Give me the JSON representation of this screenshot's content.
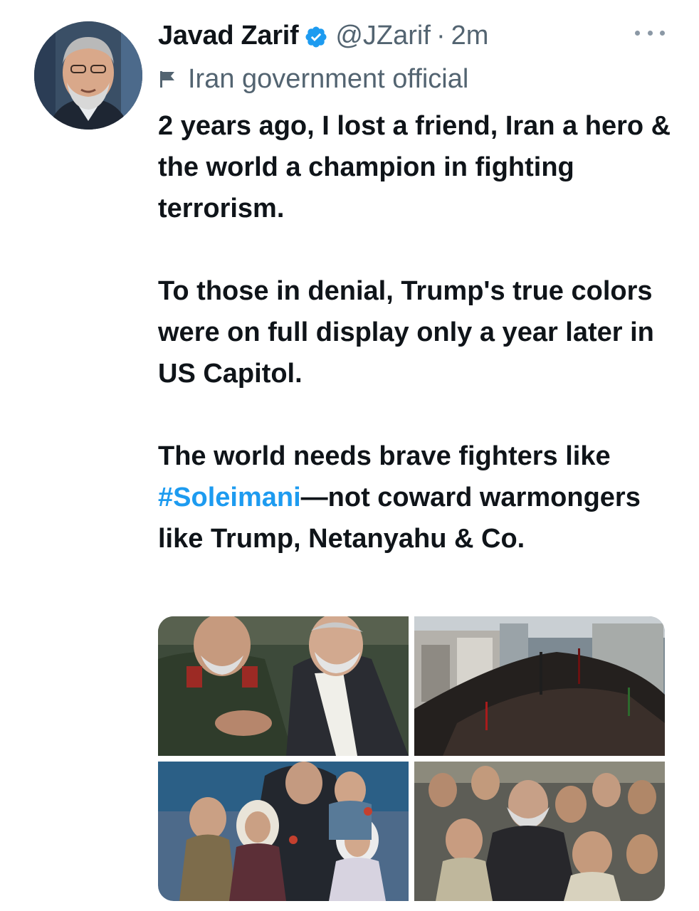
{
  "tweet": {
    "author": {
      "display_name": "Javad Zarif",
      "handle": "@JZarif",
      "verified_icon": "verified-badge-icon",
      "avatar": "profile-photo"
    },
    "separator": "·",
    "timestamp": "2m",
    "label": {
      "icon": "flag-icon",
      "text": "Iran government official"
    },
    "body": {
      "paragraph_1": "2 years ago, I lost a friend, Iran a hero & the world a champion in fighting terrorism.",
      "paragraph_2": "To those in denial, Trump's true colors were on full display only a year later in US Capitol.",
      "paragraph_3_before": "The world needs brave fighters like ",
      "hashtag": "#Soleimani",
      "paragraph_3_after": "—not coward warmongers like Trump, Netanyahu & Co."
    },
    "media": [
      {
        "name": "photo-two-men-embracing"
      },
      {
        "name": "photo-street-crowd"
      },
      {
        "name": "photo-children-with-man"
      },
      {
        "name": "photo-man-in-crowd"
      }
    ],
    "colors": {
      "text": "#0f1419",
      "secondary": "#536471",
      "link": "#1d9bf0",
      "verified": "#1d9bf0"
    }
  }
}
